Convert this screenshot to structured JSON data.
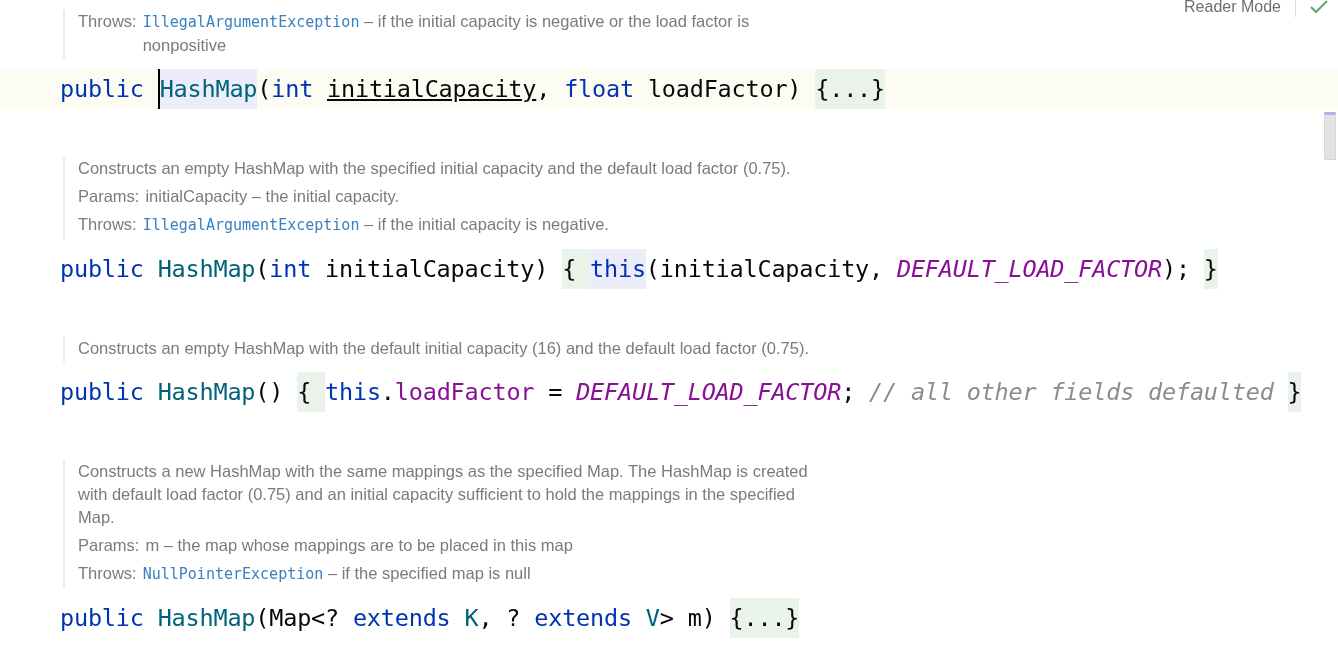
{
  "reader_mode": {
    "label": "Reader Mode",
    "ok": true
  },
  "blocks": [
    {
      "doc": [
        {
          "tag": "Throws:",
          "link": "IllegalArgumentException",
          "text": " – if the initial capacity is negative or the load factor is nonpositive"
        }
      ],
      "code": {
        "current": true,
        "tokens": [
          {
            "kind": "kw",
            "text": "public "
          },
          {
            "kind": "cls",
            "text": "HashMap",
            "usage": true,
            "caret": true
          },
          {
            "kind": "plain",
            "text": "("
          },
          {
            "kind": "kw",
            "text": "int "
          },
          {
            "kind": "under",
            "text": "initialCapacity"
          },
          {
            "kind": "plain",
            "text": ", "
          },
          {
            "kind": "kw",
            "text": "float "
          },
          {
            "kind": "plain",
            "text": "loadFactor) "
          },
          {
            "kind": "plain",
            "text": "{...}",
            "fold": true
          }
        ]
      }
    },
    {
      "doc": [
        {
          "text": "Constructs an empty HashMap with the specified initial capacity and the default load factor (0.75)."
        },
        {
          "tag": "Params:",
          "text": "initialCapacity – the initial capacity."
        },
        {
          "tag": "Throws:",
          "link": "IllegalArgumentException",
          "text": " – if the initial capacity is negative."
        }
      ],
      "code": {
        "current": false,
        "tokens": [
          {
            "kind": "kw",
            "text": "public "
          },
          {
            "kind": "cls",
            "text": "HashMap"
          },
          {
            "kind": "plain",
            "text": "("
          },
          {
            "kind": "kw",
            "text": "int "
          },
          {
            "kind": "plain",
            "text": "initialCapacity) "
          },
          {
            "kind": "plain",
            "text": "{ ",
            "fold": true
          },
          {
            "kind": "kw",
            "text": "this",
            "usage": true
          },
          {
            "kind": "plain",
            "text": "(initialCapacity, "
          },
          {
            "kind": "const",
            "text": "DEFAULT_LOAD_FACTOR"
          },
          {
            "kind": "plain",
            "text": "); "
          },
          {
            "kind": "plain",
            "text": "}",
            "fold": true
          }
        ]
      }
    },
    {
      "doc": [
        {
          "text": "Constructs an empty HashMap with the default initial capacity (16) and the default load factor (0.75)."
        }
      ],
      "code": {
        "current": false,
        "tokens": [
          {
            "kind": "kw",
            "text": "public "
          },
          {
            "kind": "cls",
            "text": "HashMap"
          },
          {
            "kind": "plain",
            "text": "() "
          },
          {
            "kind": "plain",
            "text": "{ ",
            "fold": true
          },
          {
            "kind": "kw",
            "text": "this"
          },
          {
            "kind": "plain",
            "text": "."
          },
          {
            "kind": "field",
            "text": "loadFactor"
          },
          {
            "kind": "plain",
            "text": " = "
          },
          {
            "kind": "const",
            "text": "DEFAULT_LOAD_FACTOR"
          },
          {
            "kind": "plain",
            "text": "; "
          },
          {
            "kind": "comment",
            "text": "// all other fields defaulted "
          },
          {
            "kind": "plain",
            "text": "}",
            "fold": true
          }
        ]
      }
    },
    {
      "doc": [
        {
          "text": "Constructs a new HashMap with the same mappings as the specified Map. The HashMap is created with default load factor (0.75) and an initial capacity sufficient to hold the mappings in the specified Map."
        },
        {
          "tag": "Params:",
          "text": "m – the map whose mappings are to be placed in this map"
        },
        {
          "tag": "Throws:",
          "link": "NullPointerException",
          "text": " – if the specified map is null"
        }
      ],
      "code": {
        "current": false,
        "tokens": [
          {
            "kind": "kw",
            "text": "public "
          },
          {
            "kind": "cls",
            "text": "HashMap"
          },
          {
            "kind": "plain",
            "text": "(Map<? "
          },
          {
            "kind": "kw",
            "text": "extends "
          },
          {
            "kind": "cls",
            "text": "K"
          },
          {
            "kind": "plain",
            "text": ", ? "
          },
          {
            "kind": "kw",
            "text": "extends "
          },
          {
            "kind": "cls",
            "text": "V"
          },
          {
            "kind": "plain",
            "text": "> m) "
          },
          {
            "kind": "plain",
            "text": "{...}",
            "fold": true
          }
        ]
      }
    }
  ]
}
